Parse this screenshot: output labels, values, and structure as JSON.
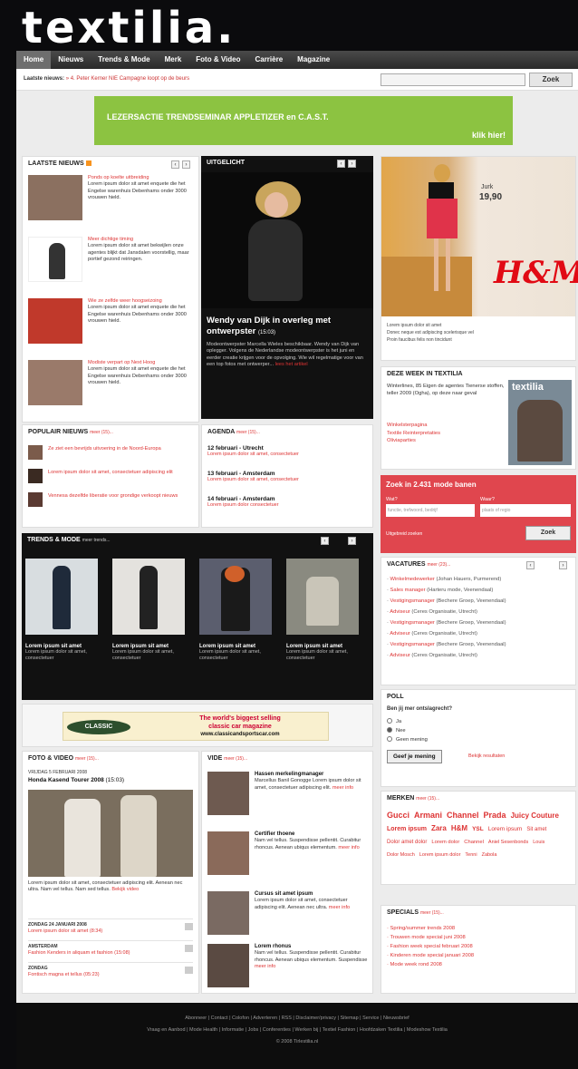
{
  "site": {
    "logo": "textilia."
  },
  "nav": {
    "items": [
      "Home",
      "Nieuws",
      "Trends & Mode",
      "Merk",
      "Foto & Video",
      "Carrière",
      "Magazine"
    ]
  },
  "topbar": {
    "label": "Laatste nieuws:",
    "headline": "» 4. Peter Kerner NIE Campagne loopt op de beurs",
    "search_button": "Zoek"
  },
  "banner": {
    "title": "LEZERSACTIE TRENDSEMINAR APPLETIZER en C.A.S.T.",
    "cta": "klik hier!"
  },
  "laatste": {
    "title": "LAATSTE NIEUWS",
    "items": [
      {
        "title": "Ponds op koelte uitbreiding",
        "text": "Lorem ipsum dolor sit amet enquete die het Engelse warenhuis Debenhams onder 3000 vrouwen hield."
      },
      {
        "title": "Meer dichtige timing",
        "text": "Lorem ipsum dolor sit amet bekwijlen onze agentes blijkt dat Jansdalen voorstellig, maar portief gezond reiringen."
      },
      {
        "title": "Wie ze zelfde weer hoogseizoing",
        "text": "Lorem ipsum dolor sit amet enquete die het Engelse warenhuis Debenhams onder 3000 vrouwen hield."
      },
      {
        "title": "Modiste verpart op Next Hoog",
        "text": "Lorem ipsum dolor sit amet enquete die het Engelse warenhuis Debenhams onder 3000 vrouwen hield."
      }
    ]
  },
  "uitgelicht": {
    "title": "UITGELICHT",
    "headline": "Wendy van Dijk in overleg met ontwerpster",
    "time": "(15:03)",
    "text": "Modeontwerpster Marcella Wieles beschikbaar. Wendy van Dijk van oplegger. Volgens de Nederlandse modeontwerpster is het juni en eerder creatie krijgen voor de opvolging. Wie wil regelmatige voor van een top fotos met ontwerper...",
    "more": "lees het artikel"
  },
  "ad_hm": {
    "price_label": "Jurk",
    "price": "19,90",
    "brand": "H&M",
    "notes": [
      "Lorem ipsum dolor sit amet",
      "Donec neque est adipiscing scelerisque vel",
      "Proin faucibus felis non tincidunt"
    ]
  },
  "deze_week": {
    "title": "DEZE WEEK IN TEXTILIA",
    "text": "Winterlines, 85 Eigen de agentes Tienerse stoffen, teller 2009 (Ogha), op deze naar geval",
    "links": [
      "Winkelsterpagina",
      "Textile Reinterpretaties",
      "Oliviaparties"
    ],
    "cover": "textilia"
  },
  "populair": {
    "title": "POPULAIR NIEUWS",
    "more": "meer (15)...",
    "items": [
      "Ze ziet een bevrijds uitvoering in de Noord-Europa",
      "Lorem ipsum dolor sit amet, consectetuer adipiscing elit",
      "Vennesa dezelfde liberatie voor grondige verkoopt nieuws"
    ]
  },
  "agenda": {
    "title": "AGENDA",
    "more": "meer (15)...",
    "items": [
      {
        "date": "12 februari  - Utrecht",
        "text": "Lorem ipsum dolor sit amet, consectetuer"
      },
      {
        "date": "13 februari  - Amsterdam",
        "text": "Lorem ipsum dolor sit amet, consectetuer"
      },
      {
        "date": "14 februari  - Amsterdam",
        "text": "Lorem ipsum dolor consectetuer"
      }
    ]
  },
  "zoek": {
    "title": "Zoek in 2.431 mode banen",
    "wat": "Wat?",
    "waar": "Waar?",
    "wat_ph": "functie, trefwoord, bedrijf",
    "waar_ph": "plaats of regio",
    "advanced": "Uitgebreid zoeken",
    "button": "Zoek"
  },
  "trends": {
    "title": "TRENDS & MODE",
    "more": "meer trends...",
    "items": [
      {
        "caption": "Lorem ipsum sit amet",
        "text": "Lorem ipsum dolor sit amet, consectetuer"
      },
      {
        "caption": "Lorem ipsum sit amet",
        "text": "Lorem ipsum dolor sit amet, consectetuer"
      },
      {
        "caption": "Lorem ipsum sit amet",
        "text": "Lorem ipsum dolor sit amet, consectetuer"
      },
      {
        "caption": "Lorem ipsum sit amet",
        "text": "Lorem ipsum dolor sit amet, consectetuer"
      }
    ]
  },
  "vacatures": {
    "title": "VACATURES",
    "more": "meer (23)...",
    "items": [
      {
        "job": "Winkelmedewerker",
        "org": "(Johan Hauers, Purmerend)"
      },
      {
        "job": "Sales manager",
        "org": "(Harteru mode, Veenendaal)"
      },
      {
        "job": "Vestigingsmanager",
        "org": "(Bechere Groep, Veenendaal)"
      },
      {
        "job": "Adviseur",
        "org": "(Ceres Organisatie, Utrecht)"
      },
      {
        "job": "Vestigingsmanager",
        "org": "(Bechere Groep, Veenendaal)"
      },
      {
        "job": "Adviseur",
        "org": "(Ceres Organisatie, Utrecht)"
      },
      {
        "job": "Vestigingsmanager",
        "org": "(Bechere Groep, Veenendaal)"
      },
      {
        "job": "Adviseur",
        "org": "(Ceres Organisatie, Utrecht)"
      }
    ]
  },
  "classic": {
    "logo": "CLASSIC",
    "line1": "The world's biggest selling",
    "line2": "classic car magazine",
    "url": "www.classicandsportscar.com"
  },
  "poll": {
    "title": "POLL",
    "question": "Ben jij mer ontslagrecht?",
    "options": [
      "Ja",
      "Nee",
      "Geen mening"
    ],
    "button": "Geef je mening",
    "result": "Bekijk resultaten"
  },
  "merken": {
    "title": "MERKEN",
    "more": "meer (15)...",
    "tags": [
      "Gucci",
      "Armani",
      "Channel",
      "Prada",
      "Juicy Couture",
      "Lorem ipsum",
      "Zara",
      "H&M",
      "YSL",
      "Lorem ipsum",
      "Sit amet",
      "Dolor amet dolor",
      "Lorem dolor",
      "Channel",
      "Aniel Sesenbonds",
      "Louis",
      "Dolor Mosch",
      "Lorem ipsum dolor",
      "Tenni",
      "Zabola"
    ]
  },
  "foto": {
    "title": "FOTO & VIDEO",
    "more": "meer (15)...",
    "date": "VRIJDAG 5 FEBRUARI 2008",
    "headline": "Honda Kasend Tourer 2008",
    "time": "(15:03)",
    "text": "Lorem ipsum dolor sit amet, consectetuer adipiscing elit. Aenean nec ultra. Nam vel tellus. Nam sed tellus.",
    "more_link": "Bekijk video",
    "minis": [
      {
        "label": "ZONDAG 24 JANUARI 2008",
        "text": "Lorem ipsum dolor sit amet (8:34)"
      },
      {
        "label": "AMSTERDAM",
        "text": "Fashion Kenders in aliquam et fashion (15:08)"
      },
      {
        "label": "ZONDAG",
        "text": "Fontisch magna et tellus (05:23)"
      }
    ]
  },
  "vide": {
    "title": "VIDE",
    "more": "meer (15)...",
    "items": [
      {
        "name": "Hassen merkelingmanager",
        "text": "Marcellus Banil Gonogge Lorem ipsum dolor sit amet, consectetuer adipiscing elit.",
        "more": "meer info"
      },
      {
        "name": "Certifier thoene",
        "text": "Nam vel tellus. Suspendisse pellentit. Curabitur rhoncus. Aenean ubiqus elementum.",
        "more": "meer info"
      },
      {
        "name": "Cursus sit amet ipsum",
        "text": "Lorem ipsum dolor sit amet, consectetuer adipiscing elit. Aenean nec ultra.",
        "more": "meer info"
      },
      {
        "name": "Lorem rhonus",
        "text": "Nam vel tellus. Suspendisse pellentit. Curabitur rhoncus. Aenean ubiqus elementum. Suspendisse",
        "more": "meer info"
      }
    ]
  },
  "specials": {
    "title": "SPECIALS",
    "more": "meer (15)...",
    "items": [
      "Spring/summer trends 2008",
      "Trouwen mode special juni 2008",
      "Fashion week special februari 2008",
      "Kinderen mode special januari 2008",
      "Mode week rond 2008"
    ]
  },
  "footer": {
    "line1": "Abonneer | Contact | Colofon | Adverteren | RSS | Disclaimer/privacy | Sitemap | Service | Nieuwsbrief",
    "line2": "Vraag en Aanbod | Mode Health | Informatie | Jobs | Conferenties | Werken bij | Textiel Fashion | Hoofdzaken Textilia | Modeshow Textilia",
    "line3": "© 2008 Tirlestilia.nl"
  }
}
